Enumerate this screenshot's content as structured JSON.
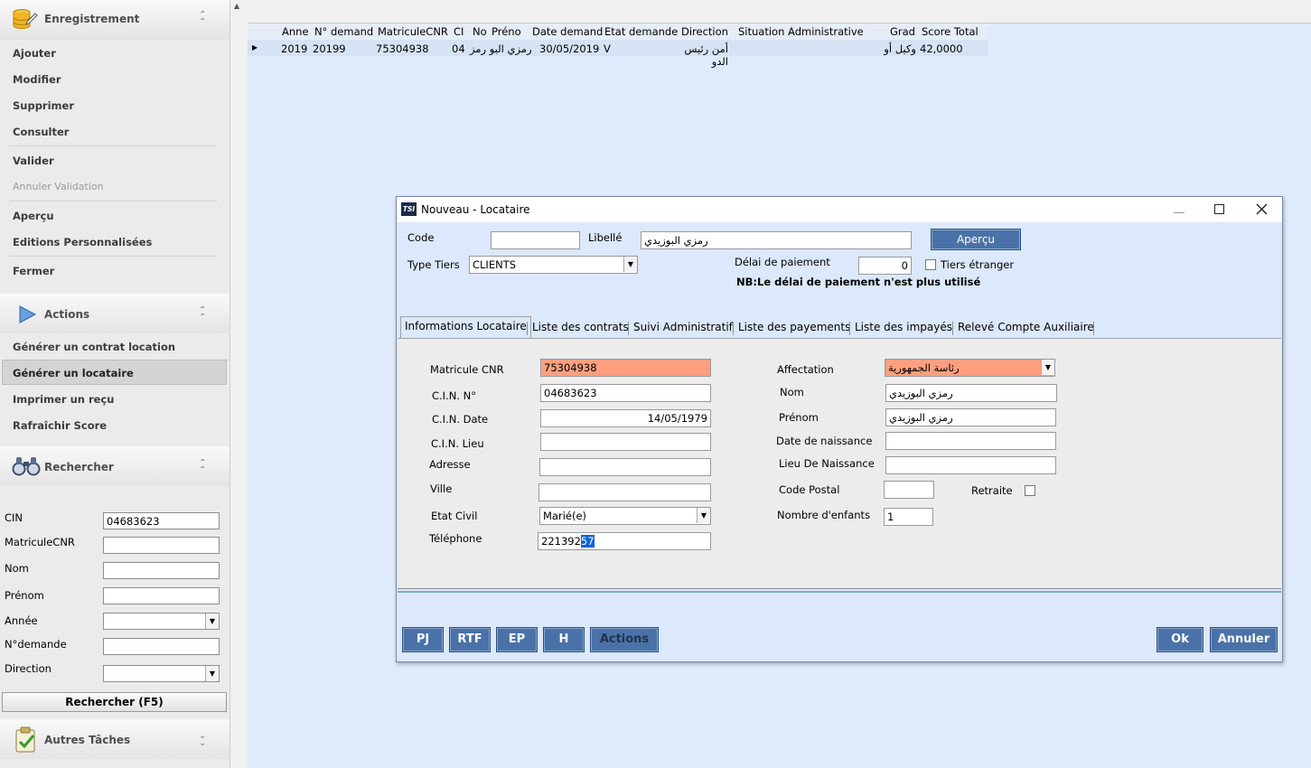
{
  "sidebar": {
    "sections": {
      "enregistrement": "Enregistrement",
      "actions": "Actions",
      "rechercher": "Rechercher",
      "autres": "Autres Tâches"
    },
    "enregistrement_items": [
      "Ajouter",
      "Modifier",
      "Supprimer",
      "Consulter",
      "Valider",
      "Annuler Validation",
      "Aperçu",
      "Editions Personnalisées",
      "Fermer"
    ],
    "actions_items": [
      "Générer un contrat location",
      "Générer un locataire",
      "Imprimer un reçu",
      "Rafraîchir Score"
    ],
    "search_fields": {
      "cin_label": "CIN",
      "cin_value": "04683623",
      "matricule_label": "MatriculeCNR",
      "matricule_value": "",
      "nom_label": "Nom",
      "nom_value": "",
      "prenom_label": "Prénom",
      "prenom_value": "",
      "annee_label": "Année",
      "annee_value": "",
      "ndemande_label": "N°demande",
      "ndemande_value": "",
      "direction_label": "Direction",
      "direction_value": ""
    },
    "search_button": "Rechercher (F5)"
  },
  "grid": {
    "headers": [
      "Anne",
      "N° demand",
      "MatriculeCNR",
      "CI",
      "No",
      "Préno",
      "Date demand",
      "Etat demande",
      "Direction",
      "Situation Administrative",
      "Grad",
      "Score Total"
    ],
    "row": {
      "annee": "2019",
      "ndemande": "20199",
      "matricule": "75304938",
      "ci": "04",
      "nom_prenom": "رمزي البو رمز",
      "date": "30/05/2019",
      "etat": "V",
      "direction": "أمن رئيس الدو",
      "grade": "وكيل أو",
      "score": "42,0000"
    }
  },
  "dialog": {
    "title": "Nouveau - Locataire",
    "app_logo": "TSI",
    "code_label": "Code",
    "code_value": "",
    "libelle_label": "Libellé",
    "libelle_value": "رمزي البوزيدي",
    "apercu_button": "Aperçu",
    "type_tiers_label": "Type Tiers",
    "type_tiers_value": "CLIENTS",
    "delai_label": "Délai de paiement",
    "delai_value": "0",
    "tiers_etranger_label": "Tiers étranger",
    "nb_note": "NB:Le délai de paiement n'est plus utilisé",
    "tabs": [
      "Informations Locataire",
      "Liste des contrats",
      "Suivi Administratif",
      "Liste des payements",
      "Liste des impayés",
      "Relevé Compte Auxiliaire"
    ],
    "form": {
      "matricule_label": "Matricule CNR",
      "matricule_value": "75304938",
      "cin_label": "C.I.N. N°",
      "cin_value": "04683623",
      "cin_date_label": "C.I.N. Date",
      "cin_date_value": "14/05/1979",
      "cin_lieu_label": "C.I.N. Lieu",
      "cin_lieu_value": "",
      "adresse_label": "Adresse",
      "adresse_value": "",
      "ville_label": "Ville",
      "ville_value": "",
      "etat_civil_label": "Etat Civil",
      "etat_civil_value": "Marié(e)",
      "telephone_label": "Téléphone",
      "telephone_value_a": "221392",
      "telephone_value_b": "57",
      "affectation_label": "Affectation",
      "affectation_value": "رئاسة الجمهورية",
      "nom_label": "Nom",
      "nom_value": "رمزي البوزيدي",
      "prenom_label": "Prénom",
      "prenom_value": "رمزي البوزيدي",
      "date_naissance_label": "Date de naissance",
      "date_naissance_value": "",
      "lieu_naissance_label": "Lieu De Naissance",
      "lieu_naissance_value": "",
      "code_postal_label": "Code Postal",
      "code_postal_value": "",
      "retraite_label": "Retraite",
      "nb_enfants_label": "Nombre d'enfants",
      "nb_enfants_value": "1"
    },
    "buttons": {
      "pj": "PJ",
      "rtf": "RTF",
      "ep": "EP",
      "h": "H",
      "actions": "Actions",
      "ok": "Ok",
      "annuler": "Annuler"
    }
  },
  "colors": {
    "accent_button": "#4a72a8",
    "required_field": "#ff9f7f",
    "grid_background": "#dfeafb"
  }
}
